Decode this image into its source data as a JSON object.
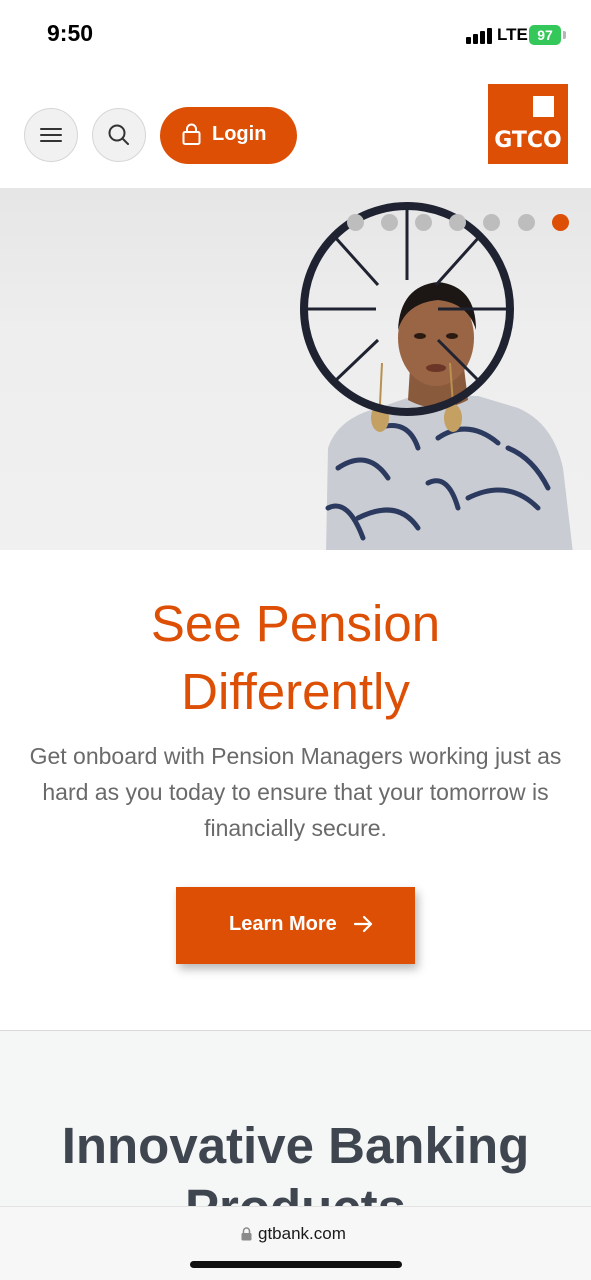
{
  "status_bar": {
    "time": "9:50",
    "network": "LTE",
    "battery": "97"
  },
  "header": {
    "login_label": "Login",
    "logo_text": "GTCO",
    "menu_icon": "hamburger-icon",
    "search_icon": "search-icon",
    "lock_icon": "lock-icon"
  },
  "hero": {
    "slide_count": 7,
    "active_slide": 7
  },
  "promo": {
    "title_line1": "See Pension",
    "title_line2": "Differently",
    "description": "Get onboard with Pension Managers working just as hard as you today to ensure that your tomorrow is financially secure.",
    "button_label": "Learn More"
  },
  "products": {
    "title": "Innovative Banking Products"
  },
  "browser": {
    "url": "gtbank.com"
  },
  "colors": {
    "brand": "#dd4f05",
    "heading_dark": "#3f4650",
    "body_text": "#6a6a6a"
  }
}
